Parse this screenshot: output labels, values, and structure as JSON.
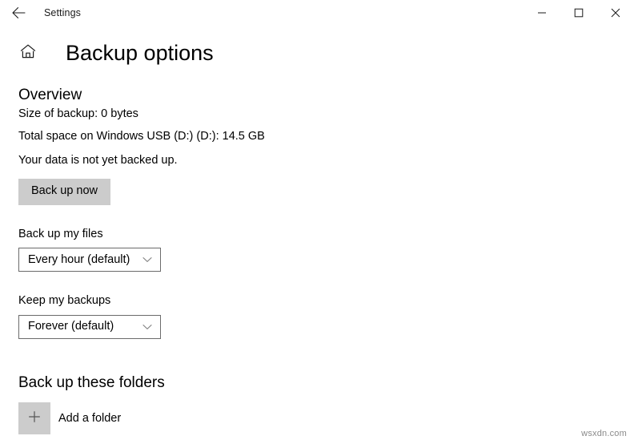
{
  "window": {
    "titlebar_title": "Settings",
    "back_icon": "back-arrow-icon",
    "minimize_icon": "minimize-icon",
    "maximize_icon": "maximize-icon",
    "close_icon": "close-icon"
  },
  "page": {
    "home_icon": "home-icon",
    "title": "Backup options"
  },
  "overview": {
    "heading": "Overview",
    "size_of_backup": "Size of backup: 0 bytes",
    "total_space": "Total space on Windows USB (D:) (D:): 14.5 GB",
    "status": "Your data is not yet backed up.",
    "backup_now_label": "Back up now"
  },
  "settings_fields": [
    {
      "label": "Back up my files",
      "value": "Every hour (default)",
      "chevron_icon": "chevron-down-icon"
    },
    {
      "label": "Keep my backups",
      "value": "Forever (default)",
      "chevron_icon": "chevron-down-icon"
    }
  ],
  "folders": {
    "heading": "Back up these folders",
    "add_icon": "plus-icon",
    "add_label": "Add a folder"
  },
  "watermark": "wsxdn.com",
  "colors": {
    "button_gray": "#cccccc",
    "combo_border": "#6b6b6b",
    "text": "#000000",
    "background": "#ffffff",
    "watermark": "#8a8a8a"
  }
}
